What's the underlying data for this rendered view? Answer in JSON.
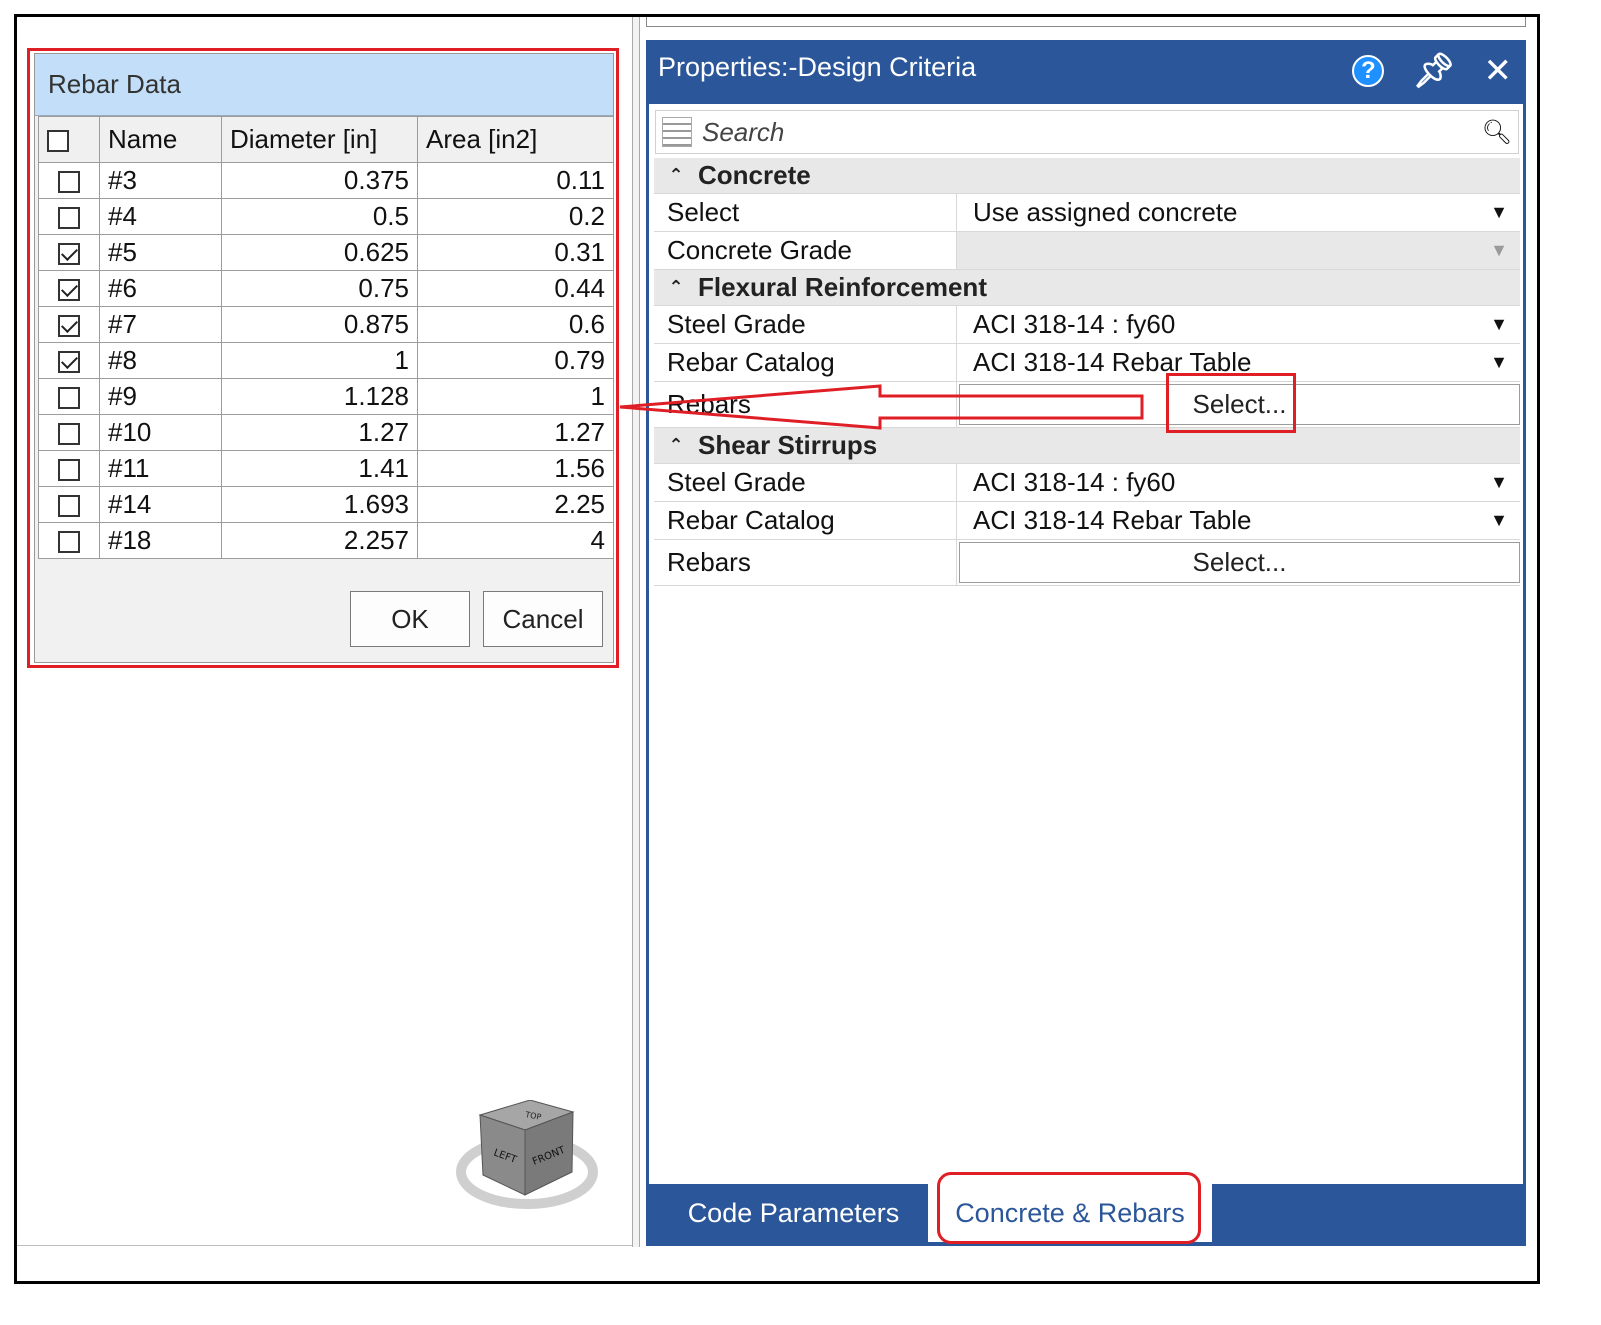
{
  "rebar_dialog": {
    "title": "Rebar Data",
    "columns": {
      "name": "Name",
      "diameter": "Diameter [in]",
      "area": "Area [in2]"
    },
    "select_all_checked": false,
    "rows": [
      {
        "name": "#3",
        "diameter": "0.375",
        "area": "0.11",
        "checked": false
      },
      {
        "name": "#4",
        "diameter": "0.5",
        "area": "0.2",
        "checked": false
      },
      {
        "name": "#5",
        "diameter": "0.625",
        "area": "0.31",
        "checked": true
      },
      {
        "name": "#6",
        "diameter": "0.75",
        "area": "0.44",
        "checked": true
      },
      {
        "name": "#7",
        "diameter": "0.875",
        "area": "0.6",
        "checked": true
      },
      {
        "name": "#8",
        "diameter": "1",
        "area": "0.79",
        "checked": true
      },
      {
        "name": "#9",
        "diameter": "1.128",
        "area": "1",
        "checked": false
      },
      {
        "name": "#10",
        "diameter": "1.27",
        "area": "1.27",
        "checked": false
      },
      {
        "name": "#11",
        "diameter": "1.41",
        "area": "1.56",
        "checked": false
      },
      {
        "name": "#14",
        "diameter": "1.693",
        "area": "2.25",
        "checked": false
      },
      {
        "name": "#18",
        "diameter": "2.257",
        "area": "4",
        "checked": false
      }
    ],
    "ok_label": "OK",
    "cancel_label": "Cancel"
  },
  "properties": {
    "title": "Properties:-Design Criteria",
    "search_placeholder": "Search",
    "concrete": {
      "header": "Concrete",
      "select_label": "Select",
      "select_value": "Use assigned concrete",
      "grade_label": "Concrete Grade",
      "grade_value": ""
    },
    "flexural": {
      "header": "Flexural Reinforcement",
      "steel_label": "Steel Grade",
      "steel_value": "ACI 318-14 : fy60",
      "catalog_label": "Rebar Catalog",
      "catalog_value": "ACI 318-14 Rebar Table",
      "rebars_label": "Rebars",
      "rebars_button": "Select..."
    },
    "shear": {
      "header": "Shear Stirrups",
      "steel_label": "Steel Grade",
      "steel_value": "ACI 318-14 : fy60",
      "catalog_label": "Rebar Catalog",
      "catalog_value": "ACI 318-14 Rebar Table",
      "rebars_label": "Rebars",
      "rebars_button": "Select..."
    },
    "tabs": [
      "Code Parameters",
      "Concrete & Rebars"
    ],
    "active_tab": "Concrete & Rebars"
  },
  "viewcube": {
    "top": "TOP",
    "left": "LEFT",
    "front": "FRONT"
  },
  "colors": {
    "accent_blue": "#2b579a",
    "header_blue": "#c3def8",
    "annotation_red": "#e01e26",
    "help_blue": "#1e90ff"
  },
  "icons": [
    "help-icon",
    "pin-icon",
    "close-icon",
    "search-icon",
    "list-view-icon",
    "chevron-up-icon",
    "dropdown-arrow-icon",
    "viewcube-icon"
  ]
}
